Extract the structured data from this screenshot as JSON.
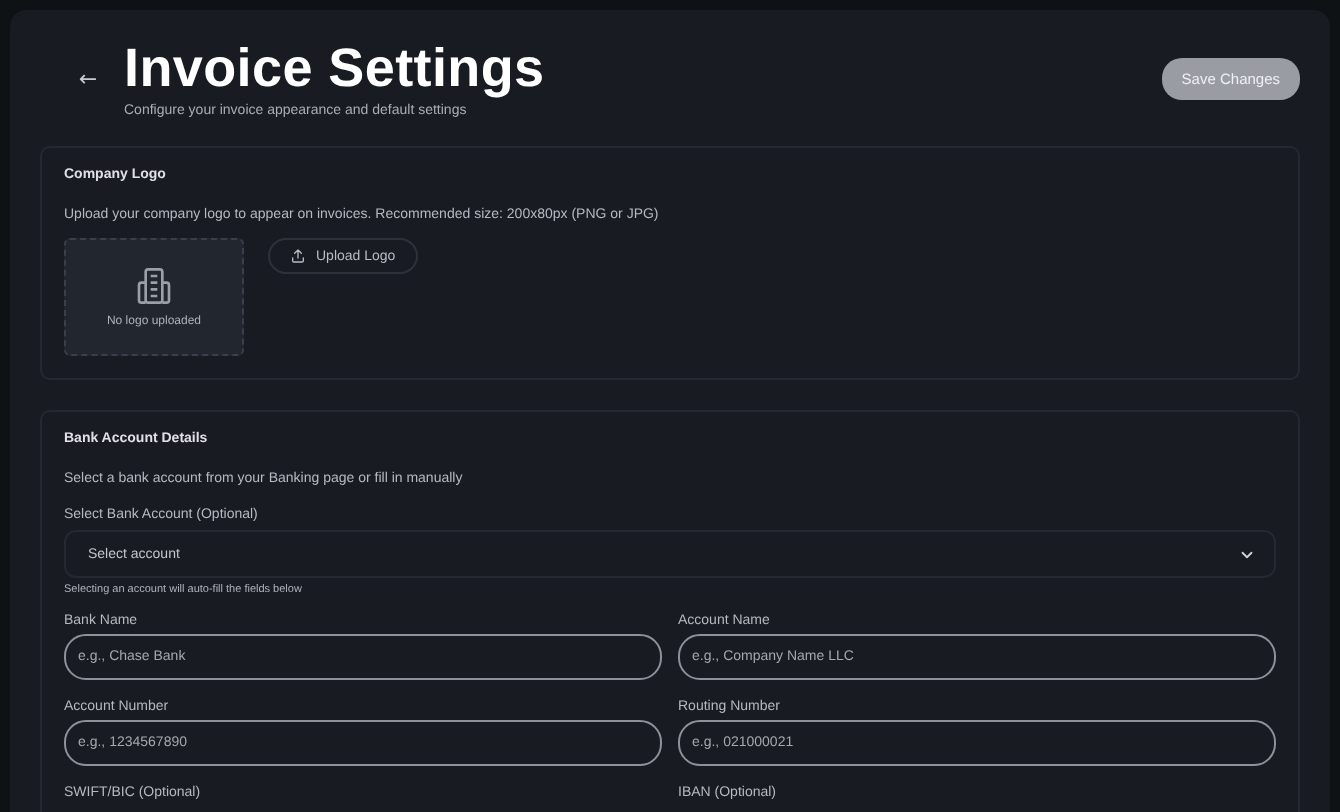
{
  "header": {
    "back_label": "←",
    "title": "Invoice Settings",
    "subtitle": "Configure your invoice appearance and default settings",
    "save_button": "Save Changes",
    "save_disabled": true
  },
  "company_logo": {
    "title": "Company Logo",
    "description": "Upload your company logo to appear on invoices. Recommended size: 200x80px (PNG or JPG)",
    "empty_text": "No logo uploaded",
    "upload_button": "Upload Logo"
  },
  "bank_account": {
    "title": "Bank Account Details",
    "description": "Select a bank account from your Banking page or fill in manually",
    "select_label": "Select Bank Account (Optional)",
    "select_placeholder": "Select account",
    "select_hint": "Selecting an account will auto-fill the fields below",
    "fields": [
      {
        "label": "Bank Name",
        "placeholder": "e.g., Chase Bank"
      },
      {
        "label": "Account Name",
        "placeholder": "e.g., Company Name LLC"
      },
      {
        "label": "Account Number",
        "placeholder": "e.g., 1234567890"
      },
      {
        "label": "Routing Number",
        "placeholder": "e.g., 021000021"
      },
      {
        "label": "SWIFT/BIC (Optional)"
      },
      {
        "label": "IBAN (Optional)"
      }
    ]
  }
}
